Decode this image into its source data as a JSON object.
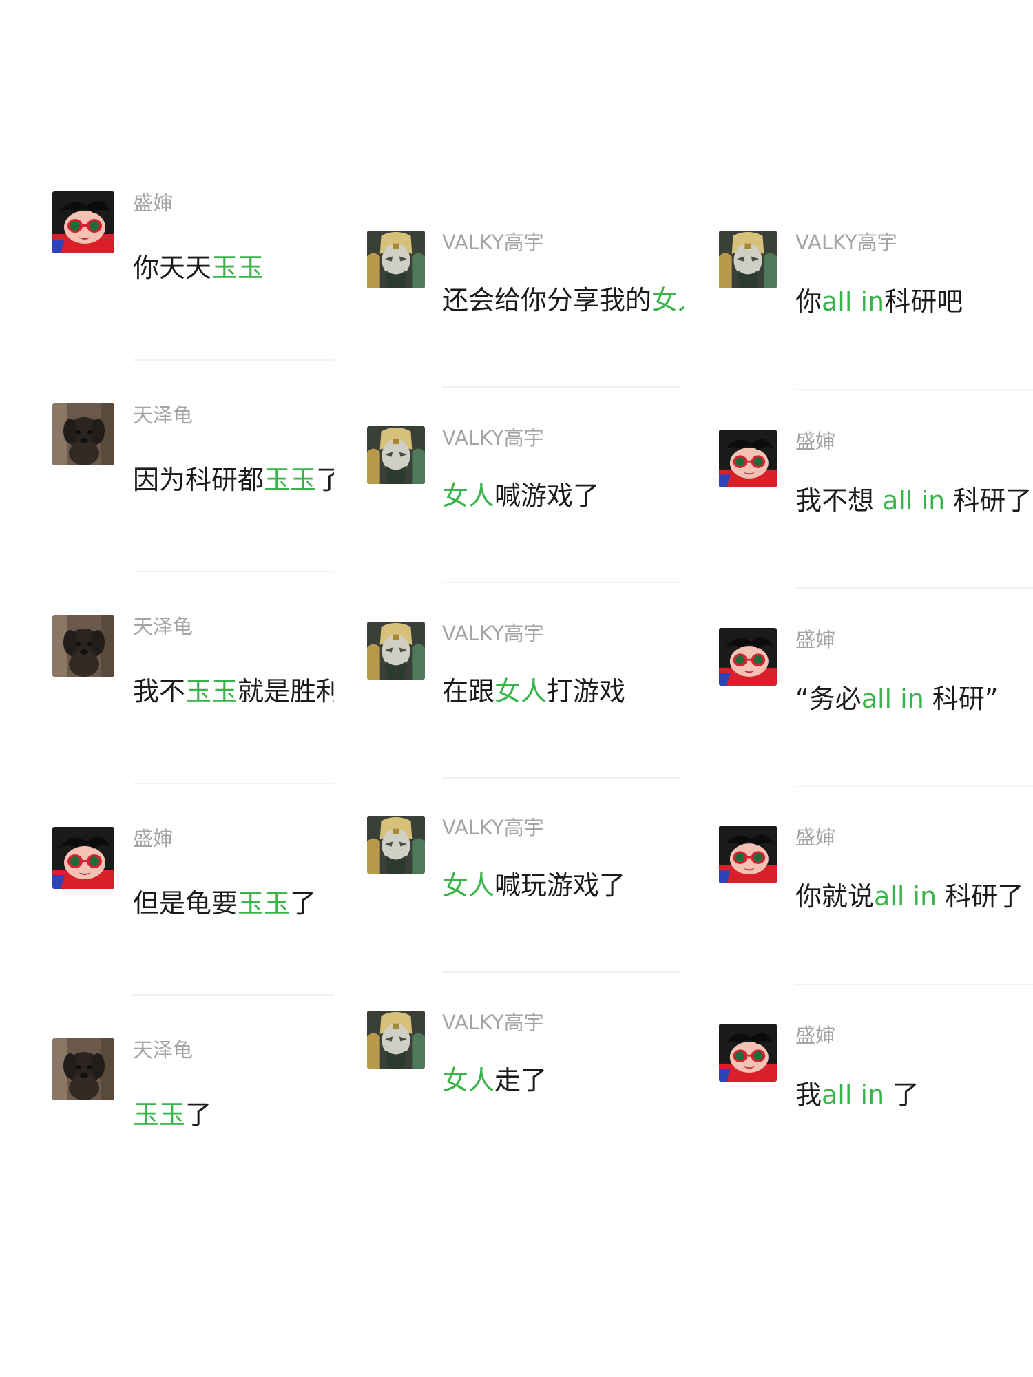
{
  "colors": {
    "background": "#ffffff",
    "sender_text": "#a4a4a4",
    "message_text": "#1b1b1b",
    "highlight": "#39b44a",
    "divider": "#f1f1f1"
  },
  "columns": [
    {
      "messages": [
        {
          "sender": "盛婶",
          "avatar": "sunglasses-cartoon-avatar",
          "segments": [
            {
              "text": "你天天",
              "hl": false
            },
            {
              "text": "玉玉",
              "hl": true
            }
          ]
        },
        {
          "sender": "天泽龟",
          "avatar": "dog-photo-avatar",
          "segments": [
            {
              "text": "因为科研都",
              "hl": false
            },
            {
              "text": "玉玉",
              "hl": true
            },
            {
              "text": "了",
              "hl": false
            }
          ]
        },
        {
          "sender": "天泽龟",
          "avatar": "dog-photo-avatar",
          "segments": [
            {
              "text": "我不",
              "hl": false
            },
            {
              "text": "玉玉",
              "hl": true
            },
            {
              "text": "就是胜利",
              "hl": false
            }
          ]
        },
        {
          "sender": "盛婶",
          "avatar": "sunglasses-cartoon-avatar",
          "segments": [
            {
              "text": "但是龟要",
              "hl": false
            },
            {
              "text": "玉玉",
              "hl": true
            },
            {
              "text": "了",
              "hl": false
            }
          ]
        },
        {
          "sender": "天泽龟",
          "avatar": "dog-photo-avatar",
          "segments": [
            {
              "text": "玉玉",
              "hl": true
            },
            {
              "text": "了",
              "hl": false
            }
          ]
        }
      ]
    },
    {
      "messages": [
        {
          "sender": "VALKY高宇",
          "avatar": "masked-character-avatar",
          "segments": [
            {
              "text": "还会给你分享我的",
              "hl": false
            },
            {
              "text": "女人",
              "hl": true
            }
          ]
        },
        {
          "sender": "VALKY高宇",
          "avatar": "masked-character-avatar",
          "segments": [
            {
              "text": "女人",
              "hl": true
            },
            {
              "text": "喊游戏了",
              "hl": false
            }
          ]
        },
        {
          "sender": "VALKY高宇",
          "avatar": "masked-character-avatar",
          "segments": [
            {
              "text": "在跟",
              "hl": false
            },
            {
              "text": "女人",
              "hl": true
            },
            {
              "text": "打游戏",
              "hl": false
            }
          ]
        },
        {
          "sender": "VALKY高宇",
          "avatar": "masked-character-avatar",
          "segments": [
            {
              "text": "女人",
              "hl": true
            },
            {
              "text": "喊玩游戏了",
              "hl": false
            }
          ]
        },
        {
          "sender": "VALKY高宇",
          "avatar": "masked-character-avatar",
          "segments": [
            {
              "text": "女人",
              "hl": true
            },
            {
              "text": "走了",
              "hl": false
            }
          ]
        }
      ]
    },
    {
      "messages": [
        {
          "sender": "VALKY高宇",
          "avatar": "masked-character-avatar",
          "segments": [
            {
              "text": "你",
              "hl": false
            },
            {
              "text": "all in",
              "hl": true
            },
            {
              "text": "科研吧",
              "hl": false
            }
          ]
        },
        {
          "sender": "盛婶",
          "avatar": "sunglasses-cartoon-avatar",
          "segments": [
            {
              "text": "我不想 ",
              "hl": false
            },
            {
              "text": "all in",
              "hl": true
            },
            {
              "text": " 科研了",
              "hl": false
            }
          ]
        },
        {
          "sender": "盛婶",
          "avatar": "sunglasses-cartoon-avatar",
          "segments": [
            {
              "text": "“务必",
              "hl": false
            },
            {
              "text": "all in",
              "hl": true
            },
            {
              "text": " 科研”",
              "hl": false
            }
          ]
        },
        {
          "sender": "盛婶",
          "avatar": "sunglasses-cartoon-avatar",
          "segments": [
            {
              "text": "你就说",
              "hl": false
            },
            {
              "text": "all in",
              "hl": true
            },
            {
              "text": " 科研了",
              "hl": false
            }
          ]
        },
        {
          "sender": "盛婶",
          "avatar": "sunglasses-cartoon-avatar",
          "segments": [
            {
              "text": "我",
              "hl": false
            },
            {
              "text": "all in",
              "hl": true
            },
            {
              "text": " 了",
              "hl": false
            }
          ]
        }
      ]
    }
  ]
}
